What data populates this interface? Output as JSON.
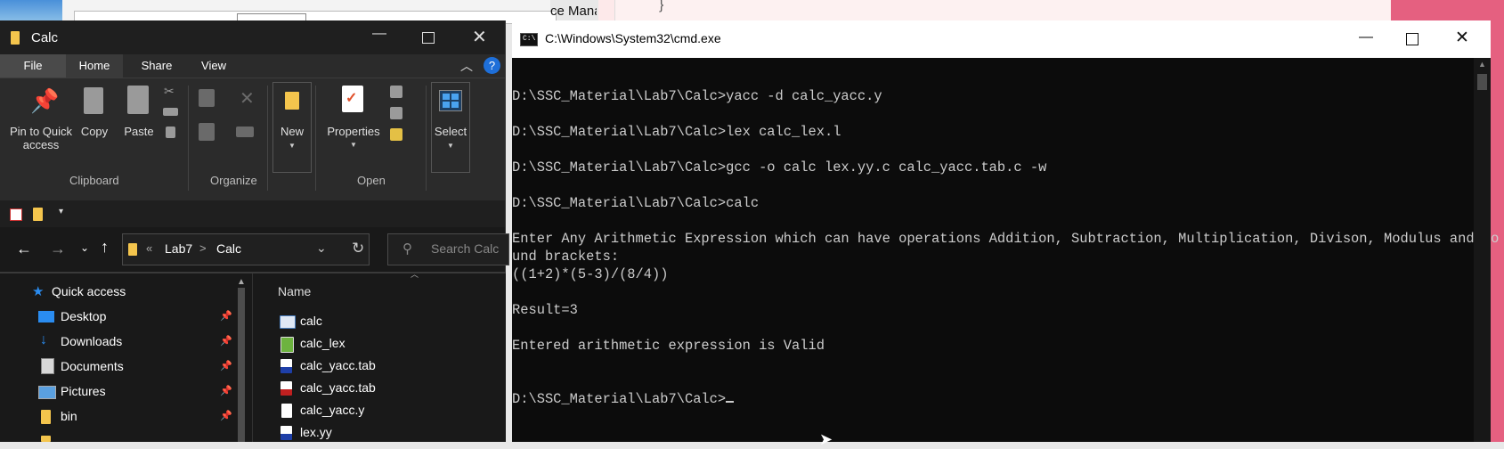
{
  "background": {
    "partial_text": "ce Mana",
    "brace": "}"
  },
  "explorer": {
    "title": "Calc",
    "tabs": [
      "File",
      "Home",
      "Share",
      "View"
    ],
    "ribbon": {
      "pin_label_1": "Pin to Quick",
      "pin_label_2": "access",
      "copy": "Copy",
      "paste": "Paste",
      "new": "New",
      "properties": "Properties",
      "select": "Select",
      "groups": [
        "Clipboard",
        "Organize",
        "Open"
      ]
    },
    "address": {
      "overflow": "«",
      "crumbs": [
        "Lab7",
        "Calc"
      ],
      "separator": ">",
      "search_placeholder": "Search Calc"
    },
    "nav_pane": {
      "items": [
        {
          "label": "Quick access",
          "icon": "star-icon"
        },
        {
          "label": "Desktop",
          "icon": "desktop-icon",
          "pinned": true
        },
        {
          "label": "Downloads",
          "icon": "download-icon",
          "pinned": true
        },
        {
          "label": "Documents",
          "icon": "documents-icon",
          "pinned": true
        },
        {
          "label": "Pictures",
          "icon": "pictures-icon",
          "pinned": true
        },
        {
          "label": "bin",
          "icon": "folder-icon",
          "pinned": true
        }
      ]
    },
    "files": {
      "column_header": "Name",
      "items": [
        {
          "name": "calc",
          "icon": "exe-icon"
        },
        {
          "name": "calc_lex",
          "icon": "lex-file-icon"
        },
        {
          "name": "calc_yacc.tab",
          "icon": "c-file-icon"
        },
        {
          "name": "calc_yacc.tab",
          "icon": "h-file-icon"
        },
        {
          "name": "calc_yacc.y",
          "icon": "blank-file-icon"
        },
        {
          "name": "lex.yy",
          "icon": "c-file-icon"
        }
      ]
    }
  },
  "cmd": {
    "title": "C:\\Windows\\System32\\cmd.exe",
    "lines": [
      "D:\\SSC_Material\\Lab7\\Calc>yacc -d calc_yacc.y",
      "D:\\SSC_Material\\Lab7\\Calc>lex calc_lex.l",
      "D:\\SSC_Material\\Lab7\\Calc>gcc -o calc lex.yy.c calc_yacc.tab.c -w",
      "D:\\SSC_Material\\Lab7\\Calc>calc",
      "Enter Any Arithmetic Expression which can have operations Addition, Subtraction, Multiplication, Divison, Modulus and Ro",
      "und brackets:",
      "((1+2)*(5-3)/(8/4))",
      "Result=3",
      "Entered arithmetic expression is Valid",
      "D:\\SSC_Material\\Lab7\\Calc>"
    ]
  }
}
